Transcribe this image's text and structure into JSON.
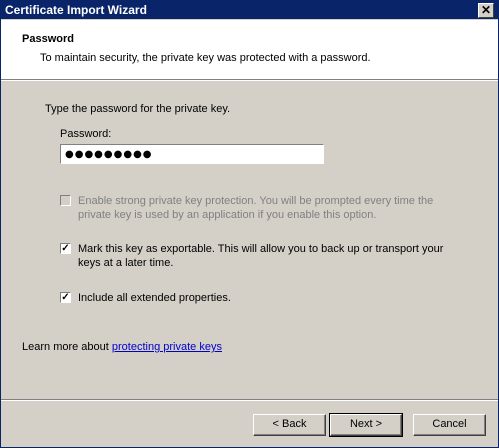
{
  "window": {
    "title": "Certificate Import Wizard",
    "close_glyph": "✕"
  },
  "header": {
    "title": "Password",
    "subtitle": "To maintain security, the private key was protected with a password."
  },
  "main": {
    "prompt": "Type the password for the private key.",
    "password_label": "Password:",
    "password_value": "●●●●●●●●●",
    "options": [
      {
        "text": "Enable strong private key protection. You will be prompted every time the private key is used by an application if you enable this option.",
        "checked": false,
        "disabled": true
      },
      {
        "text": "Mark this key as exportable. This will allow you to back up or transport your keys at a later time.",
        "checked": true,
        "disabled": false
      },
      {
        "text": "Include all extended properties.",
        "checked": true,
        "disabled": false
      }
    ],
    "learn_prefix": "Learn more about ",
    "learn_link": "protecting private keys"
  },
  "buttons": {
    "back": "< Back",
    "next": "Next >",
    "cancel": "Cancel"
  },
  "colors": {
    "titlebar": "#0a246a",
    "dialog_bg": "#d4d0c8",
    "link": "#0000cc"
  }
}
